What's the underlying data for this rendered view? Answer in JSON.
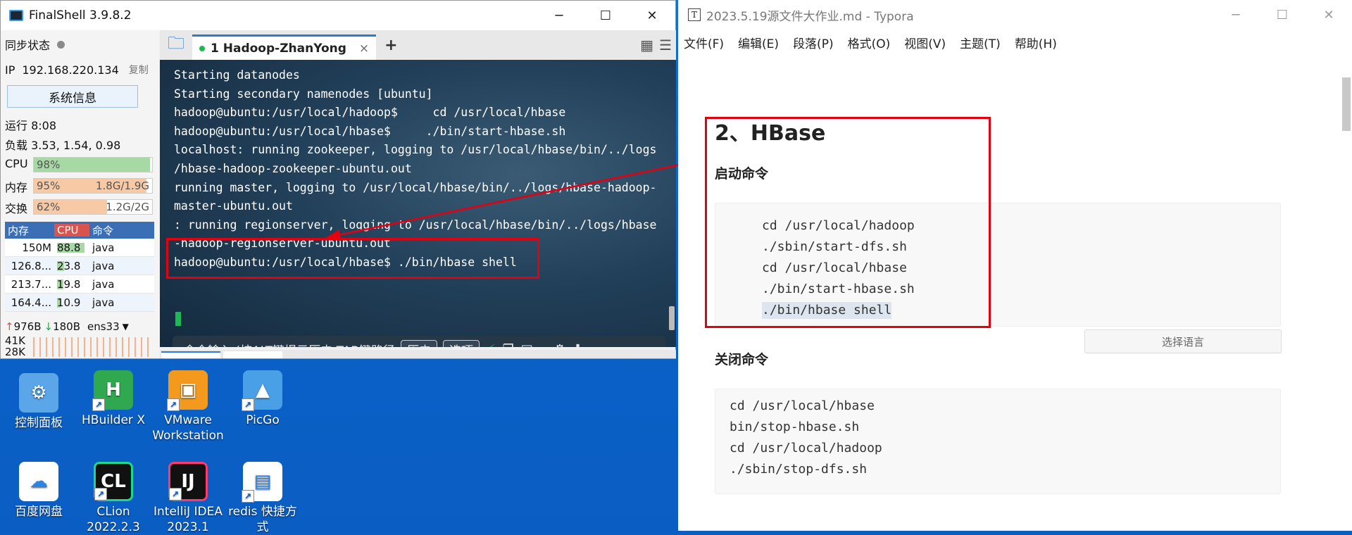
{
  "finalshell": {
    "title": "FinalShell 3.9.8.2",
    "sync_label": "同步状态",
    "ip_label": "IP",
    "ip_value": "192.168.220.134",
    "copy_label": "复制",
    "sysinfo_button": "系统信息",
    "uptime": "运行 8:08",
    "load": "负载 3.53, 1.54, 0.98",
    "cpu": {
      "label": "CPU",
      "pct_text": "98%",
      "fraction": 0.98,
      "color": "#a6d9a3"
    },
    "mem": {
      "label": "内存",
      "pct_text": "95%",
      "detail": "1.8G/1.9G",
      "fraction": 0.95,
      "color": "#f7c9a5"
    },
    "swap": {
      "label": "交换",
      "pct_text": "62%",
      "detail": "1.2G/2G",
      "fraction": 0.62,
      "color": "#f7c9a5"
    },
    "process_table": {
      "headers": [
        "内存",
        "CPU",
        "命令"
      ],
      "rows": [
        {
          "mem": "150M",
          "cpu": "88.8",
          "cmd": "java"
        },
        {
          "mem": "126.8...",
          "cpu": "23.8",
          "cmd": "java"
        },
        {
          "mem": "213.7...",
          "cpu": "19.8",
          "cmd": "java"
        },
        {
          "mem": "164.4...",
          "cpu": "10.9",
          "cmd": "java"
        }
      ]
    },
    "net": {
      "up": "976B",
      "down": "180B",
      "iface": "ens33"
    },
    "net_scale": [
      "41K",
      "28K"
    ],
    "tab": {
      "label": "1 Hadoop-ZhanYong"
    },
    "terminal_lines": [
      "Starting datanodes",
      "Starting secondary namenodes [ubuntu]",
      "hadoop@ubuntu:/usr/local/hadoop$     cd /usr/local/hbase",
      "hadoop@ubuntu:/usr/local/hbase$     ./bin/start-hbase.sh",
      "localhost: running zookeeper, logging to /usr/local/hbase/bin/../logs",
      "/hbase-hadoop-zookeeper-ubuntu.out",
      "running master, logging to /usr/local/hbase/bin/../logs/hbase-hadoop-",
      "master-ubuntu.out",
      ": running regionserver, logging to /usr/local/hbase/bin/../logs/hbase",
      "-hadoop-regionserver-ubuntu.out",
      "hadoop@ubuntu:/usr/local/hbase$ ./bin/hbase shell"
    ],
    "cmd_placeholder": "命令输入 (按ALT键提示历史,TAB键路径",
    "history_button": "历史",
    "options_button": "选项"
  },
  "desktop_icons": [
    {
      "label": "控制面板",
      "icon": "control-panel-icon"
    },
    {
      "label": "HBuilder X",
      "icon": "hbuilder-icon"
    },
    {
      "label": "VMware Workstation",
      "icon": "vmware-icon"
    },
    {
      "label": "PicGo",
      "icon": "picgo-icon"
    },
    {
      "label": "百度网盘",
      "icon": "baidu-netdisk-icon"
    },
    {
      "label": "CLion 2022.2.3",
      "icon": "clion-icon"
    },
    {
      "label": "IntelliJ IDEA 2023.1",
      "icon": "intellij-icon"
    },
    {
      "label": "redis 快捷方式",
      "icon": "redis-shortcut-icon"
    }
  ],
  "typora": {
    "title": "2023.5.19源文件大作业.md - Typora",
    "menu": [
      "文件(F)",
      "编辑(E)",
      "段落(P)",
      "格式(O)",
      "视图(V)",
      "主题(T)",
      "帮助(H)"
    ],
    "heading": "2、HBase",
    "start_heading": "启动命令",
    "start_code": [
      "cd /usr/local/hadoop",
      "./sbin/start-dfs.sh",
      "cd /usr/local/hbase",
      "./bin/start-hbase.sh",
      "./bin/hbase shell"
    ],
    "lang_select": "选择语言",
    "stop_heading": "关闭命令",
    "stop_code": [
      "cd /usr/local/hbase",
      "bin/stop-hbase.sh",
      "cd /usr/local/hadoop",
      "./sbin/stop-dfs.sh"
    ]
  },
  "colors": {
    "annotation_red": "#e3000f",
    "terminal_green": "#1db954"
  }
}
